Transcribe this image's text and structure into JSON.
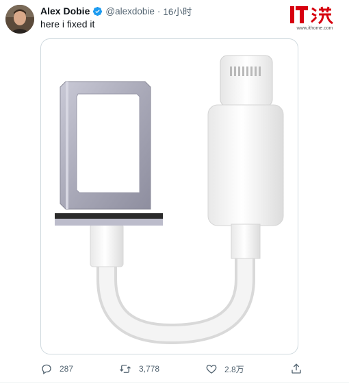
{
  "tweet": {
    "author_name": "Alex Dobie",
    "handle": "@alexdobie",
    "separator": "·",
    "time": "16小时",
    "text": "here i fixed it",
    "verified": true,
    "accent_color": "#1d9bf0"
  },
  "watermark": {
    "logo_text": "IT之家",
    "url": "www.ithome.com",
    "color": "#d7000f"
  },
  "media": {
    "icons": [
      "sim-tray-icon",
      "lightning-adapter-icon"
    ]
  },
  "actions": {
    "reply_count": "287",
    "retweet_count": "3,778",
    "like_count": "2.8万"
  }
}
